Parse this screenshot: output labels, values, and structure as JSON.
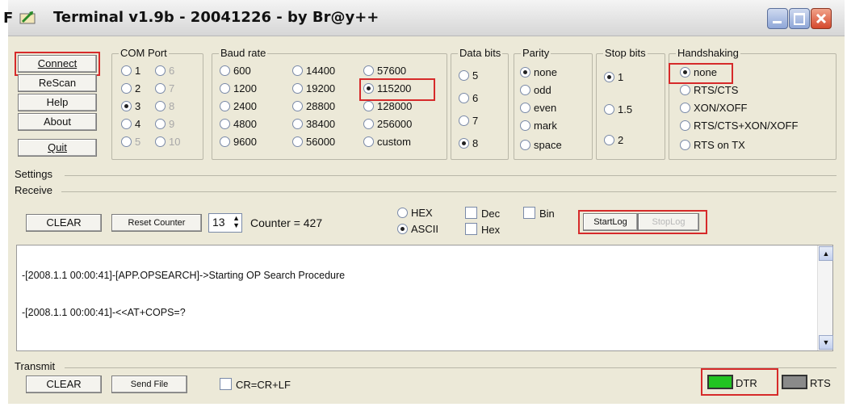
{
  "window": {
    "title_prefix": "F",
    "title": "Terminal v1.9b - 20041226 - by Br@y++"
  },
  "buttons": {
    "connect": "Connect",
    "rescan": "ReScan",
    "help": "Help",
    "about": "About",
    "quit": "Quit"
  },
  "com_port": {
    "legend": "COM Port",
    "options": [
      "1",
      "2",
      "3",
      "4",
      "5",
      "6",
      "7",
      "8",
      "9",
      "10"
    ],
    "selected": "3"
  },
  "baud_rate": {
    "legend": "Baud rate",
    "options": [
      "600",
      "1200",
      "2400",
      "4800",
      "9600",
      "14400",
      "19200",
      "28800",
      "38400",
      "56000",
      "57600",
      "115200",
      "128000",
      "256000",
      "custom"
    ],
    "selected": "115200"
  },
  "data_bits": {
    "legend": "Data bits",
    "options": [
      "5",
      "6",
      "7",
      "8"
    ],
    "selected": "8"
  },
  "parity": {
    "legend": "Parity",
    "options": [
      "none",
      "odd",
      "even",
      "mark",
      "space"
    ],
    "selected": "none"
  },
  "stop_bits": {
    "legend": "Stop bits",
    "options": [
      "1",
      "1.5",
      "2"
    ],
    "selected": "1"
  },
  "handshaking": {
    "legend": "Handshaking",
    "options": [
      "none",
      "RTS/CTS",
      "XON/XOFF",
      "RTS/CTS+XON/XOFF",
      "RTS on TX"
    ],
    "selected": "none"
  },
  "settings_label": "Settings",
  "receive": {
    "label": "Receive",
    "clear": "CLEAR",
    "reset_counter": "Reset Counter",
    "counter_value": "13",
    "counter_text": "Counter = 427",
    "hex": "HEX",
    "ascii": "ASCII",
    "dec": "Dec",
    "hex2": "Hex",
    "bin": "Bin",
    "start_log": "StartLog",
    "stop_log": "StopLog"
  },
  "log_lines": [
    "-[2008.1.1 00:00:41]-[APP.OPSEARCH]->Starting OP Search Procedure",
    "-[2008.1.1 00:00:41]-<<AT+COPS=?"
  ],
  "transmit": {
    "label": "Transmit",
    "clear": "CLEAR",
    "send_file": "Send File",
    "crlf": "CR=CR+LF",
    "dtr": "DTR",
    "rts": "RTS"
  },
  "colors": {
    "highlight": "#d62a2a",
    "dtr_led": "#22c422",
    "rts_led": "#8a8a8a"
  }
}
